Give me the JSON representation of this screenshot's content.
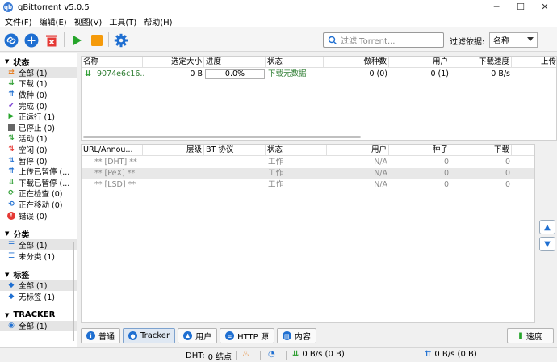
{
  "window": {
    "title": "qBittorrent v5.0.5",
    "icon_text": "qb",
    "minimize": "─",
    "maximize": "☐",
    "close": "✕"
  },
  "menu": [
    "文件(F)",
    "编辑(E)",
    "视图(V)",
    "工具(T)",
    "帮助(H)"
  ],
  "toolbar": {
    "search_placeholder": "过滤 Torrent...",
    "filter_label": "过滤依据:",
    "filter_value": "名称"
  },
  "sidebar": {
    "status_title": "状态",
    "status_items": [
      {
        "label": "全部 (1)",
        "icon": "all-icon"
      },
      {
        "label": "下载 (1)",
        "icon": "download-icon"
      },
      {
        "label": "做种 (0)",
        "icon": "seed-icon"
      },
      {
        "label": "完成 (0)",
        "icon": "check-icon"
      },
      {
        "label": "正运行 (1)",
        "icon": "play-icon"
      },
      {
        "label": "已停止 (0)",
        "icon": "stop-icon"
      },
      {
        "label": "活动 (1)",
        "icon": "active-icon"
      },
      {
        "label": "空闲 (0)",
        "icon": "idle-icon"
      },
      {
        "label": "暂停 (0)",
        "icon": "pause-icon"
      },
      {
        "label": "上传已暂停 (...",
        "icon": "upload-paused-icon"
      },
      {
        "label": "下载已暂停 (...",
        "icon": "download-paused-icon"
      },
      {
        "label": "正在检查 (0)",
        "icon": "checking-icon"
      },
      {
        "label": "正在移动 (0)",
        "icon": "moving-icon"
      },
      {
        "label": "错误 (0)",
        "icon": "error-icon"
      }
    ],
    "category_title": "分类",
    "category_items": [
      {
        "label": "全部 (1)"
      },
      {
        "label": "未分类 (1)"
      }
    ],
    "tag_title": "标签",
    "tag_items": [
      {
        "label": "全部 (1)"
      },
      {
        "label": "无标签 (1)"
      }
    ],
    "tracker_title": "TRACKER",
    "tracker_items": [
      {
        "label": "全部 (1)"
      }
    ]
  },
  "torrent_table": {
    "headers": [
      "名称",
      "选定大小",
      "进度",
      "状态",
      "做种数",
      "用户",
      "下载速度",
      "上传"
    ],
    "rows": [
      {
        "name": "9074e6c16...",
        "size": "0 B",
        "progress": "0.0%",
        "progress_value": 0,
        "status": "下载元数据",
        "seeds": "0 (0)",
        "peers": "0 (1)",
        "down": "0 B/s"
      }
    ]
  },
  "tracker_table": {
    "headers": [
      "URL/Annou...",
      "层级",
      "BT 协议",
      "状态",
      "用户",
      "种子",
      "下载"
    ],
    "rows": [
      {
        "url": "** [DHT] **",
        "status": "工作",
        "users": "N/A",
        "seeds": "0",
        "down": "0"
      },
      {
        "url": "** [PeX] **",
        "status": "工作",
        "users": "N/A",
        "seeds": "0",
        "down": "0"
      },
      {
        "url": "** [LSD] **",
        "status": "工作",
        "users": "N/A",
        "seeds": "0",
        "down": "0"
      }
    ]
  },
  "bottom_tabs": [
    {
      "label": "普通",
      "icon": "info-icon"
    },
    {
      "label": "Tracker",
      "icon": "tracker-icon"
    },
    {
      "label": "用户",
      "icon": "users-icon"
    },
    {
      "label": "HTTP 源",
      "icon": "http-icon"
    },
    {
      "label": "内容",
      "icon": "content-icon"
    }
  ],
  "speed_button": "速度",
  "statusbar": {
    "dht": "DHT:",
    "dht_nodes": "0 结点",
    "down": "0 B/s (0 B)",
    "up": "0 B/s (0 B)"
  }
}
